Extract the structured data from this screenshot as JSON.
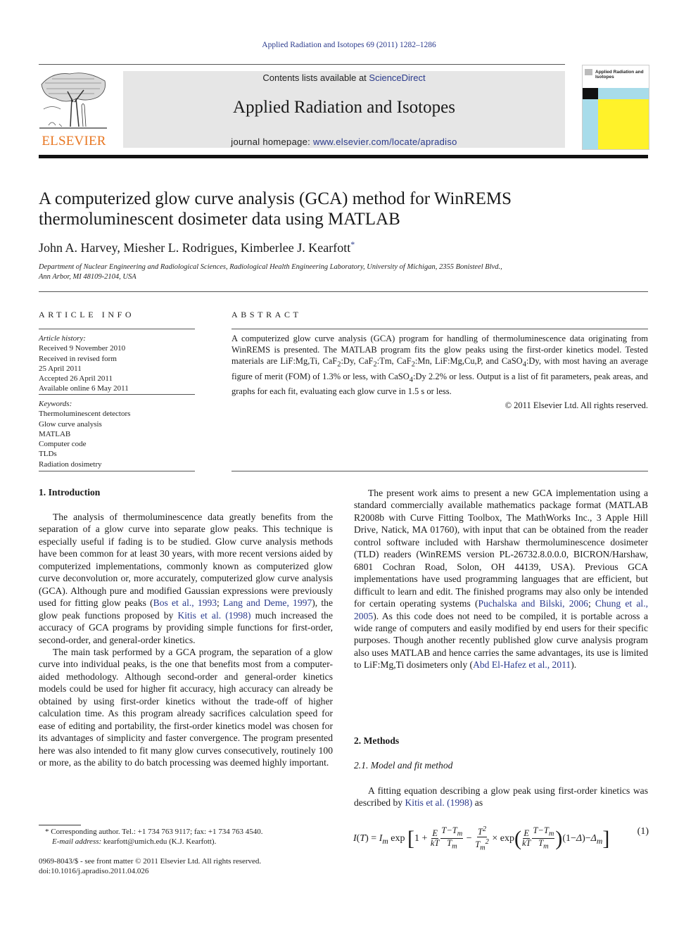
{
  "header": {
    "citation": "Applied Radiation and Isotopes 69 (2011) 1282–1286",
    "contents_prefix": "Contents lists available at ",
    "contents_link": "ScienceDirect",
    "journal_title": "Applied Radiation and Isotopes",
    "homepage_prefix": "journal homepage: ",
    "homepage_link": "www.elsevier.com/locate/apradiso",
    "publisher_logo": "ELSEVIER",
    "cover_title": "Applied Radiation and Isotopes",
    "colors": {
      "publisher_orange": "#e87722",
      "link_blue": "#2a3a8c",
      "cover_blue": "#a8dcea",
      "cover_yellow": "#fff22a",
      "banner_gray": "#e6e6e6"
    }
  },
  "article": {
    "title_line1": "A computerized glow curve analysis (GCA) method for WinREMS",
    "title_line2": "thermoluminescent dosimeter data using MATLAB",
    "authors": "John A. Harvey, Miesher L. Rodrigues, Kimberlee J. Kearfott",
    "author_mark": "*",
    "affiliation_line1": "Department of Nuclear Engineering and Radiological Sciences, Radiological Health Engineering Laboratory, University of Michigan, 2355 Bonisteel Blvd.,",
    "affiliation_line2": "Ann Arbor, MI 48109-2104, USA"
  },
  "article_info": {
    "heading": "ARTICLE INFO",
    "history_label": "Article history:",
    "history": [
      "Received 9 November 2010",
      "Received in revised form",
      "25 April 2011",
      "Accepted 26 April 2011",
      "Available online 6 May 2011"
    ],
    "keywords_label": "Keywords:",
    "keywords": [
      "Thermoluminescent detectors",
      "Glow curve analysis",
      "MATLAB",
      "Computer code",
      "TLDs",
      "Radiation dosimetry"
    ]
  },
  "abstract": {
    "heading": "ABSTRACT",
    "p1": "A computerized glow curve analysis (GCA) program for handling of thermoluminescence data originating from WinREMS is presented. The MATLAB program fits the glow peaks using the first-order kinetics model. Tested materials are LiF:Mg,Ti, CaF",
    "p2": ":Dy, CaF",
    "p3": ":Tm, CaF",
    "p4": ":Mn, LiF:Mg,Cu,P, and CaSO",
    "p5": ":Dy, with most having an average figure of merit (FOM) of 1.3% or less, with CaSO",
    "p6": ":Dy 2.2% or less. Output is a list of fit parameters, peak areas, and graphs for each fit, evaluating each glow curve in 1.5 s or less.",
    "sub2": "2",
    "sub4": "4",
    "copyright": "© 2011 Elsevier Ltd. All rights reserved."
  },
  "intro": {
    "heading": "1.  Introduction",
    "p1a": "The analysis of thermoluminescence data greatly benefits from the separation of a glow curve into separate glow peaks. This technique is especially useful if fading is to be studied. Glow curve analysis methods have been common for at least 30 years, with more recent versions aided by computerized implementations, commonly known as computerized glow curve deconvolution or, more accurately, computerized glow curve analysis (GCA). Although pure and modified Gaussian expressions were previously used for fitting glow peaks (",
    "ref_bos": "Bos et al., 1993",
    "sep1": "; ",
    "ref_lang": "Lang and Deme, 1997",
    "p1b": "), the glow peak functions proposed by ",
    "ref_kitis": "Kitis et al. (1998)",
    "p1c": " much increased the accuracy of GCA programs by providing simple functions for first-order, second-order, and general-order kinetics.",
    "p2": "The main task performed by a GCA program, the separation of a glow curve into individual peaks, is the one that benefits most from a computer-aided methodology. Although second-order and general-order kinetics models could be used for higher fit accuracy, high accuracy can already be obtained by using first-order kinetics without the trade-off of higher calculation time. As this program already sacrifices calculation speed for ease of editing and portability, the first-order kinetics model was chosen for its advantages of simplicity and faster convergence. The program presented here was also intended to fit many glow curves consecutively, routinely 100 or more, as the ability to do batch processing was deemed highly important.",
    "p3a": "The present work aims to present a new GCA implementation using a standard commercially available mathematics package format (MATLAB R2008b with Curve Fitting Toolbox, The MathWorks Inc., 3 Apple Hill Drive, Natick, MA 01760), with input that can be obtained from the reader control software included with Harshaw thermoluminescence dosimeter (TLD) readers (WinREMS version PL-26732.8.0.0.0, BICRON/Harshaw, 6801 Cochran Road, Solon, OH 44139, USA). Previous GCA implementations have used programming languages that are efficient, but difficult to learn and edit. The finished programs may also only be intended for certain operating systems (",
    "ref_puch": "Puchalska and Bilski, 2006",
    "sep2": "; ",
    "ref_chung": "Chung et al., 2005",
    "p3b": "). As this code does not need to be compiled, it is portable across a wide range of computers and easily modified by end users for their specific purposes. Though another recently published glow curve analysis program also uses MATLAB and hence carries the same advantages, its use is limited to LiF:Mg,Ti dosimeters only (",
    "ref_abd": "Abd El-Hafez et al., 2011",
    "p3c": ")."
  },
  "methods": {
    "heading": "2.  Methods",
    "subheading": "2.1.  Model and fit method",
    "p1a": "A fitting equation describing a glow peak using first-order kinetics was described by ",
    "ref_kitis": "Kitis et al. (1998)",
    "p1b": " as",
    "equation_number": "(1)"
  },
  "footnotes": {
    "corresponding": "* Corresponding author. Tel.: +1 734 763 9117; fax: +1 734 763 4540.",
    "email_label": "E-mail address: ",
    "email": "kearfott@umich.edu (K.J. Kearfott).",
    "issn": "0969-8043/$ - see front matter © 2011 Elsevier Ltd. All rights reserved.",
    "doi": "doi:10.1016/j.apradiso.2011.04.026"
  }
}
